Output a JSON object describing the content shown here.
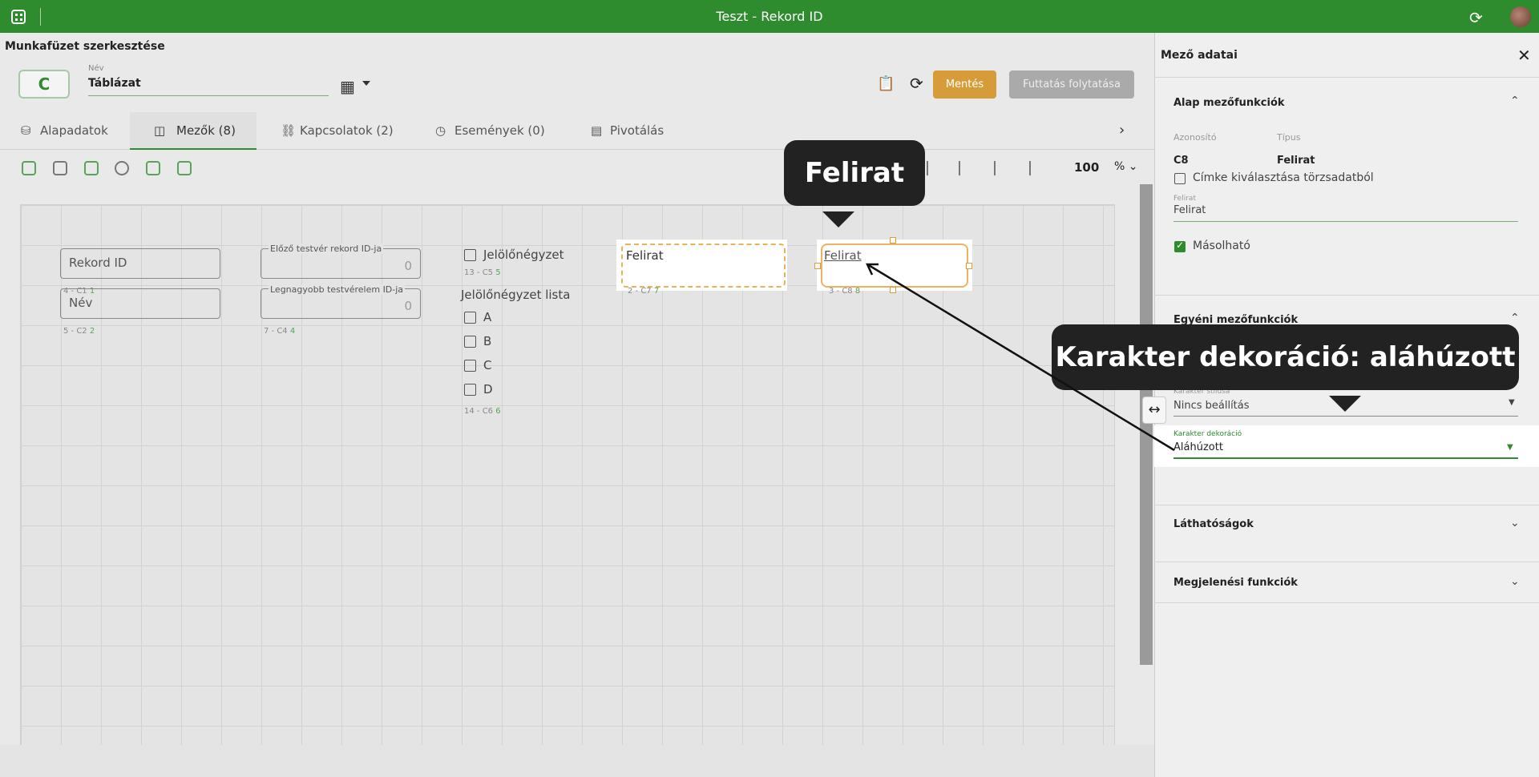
{
  "window": {
    "title": "Teszt - Rekord ID"
  },
  "header": {
    "page_title": "Munkafüzet szerkesztése",
    "logo_letter": "C",
    "name_label": "Név",
    "name_value": "Táblázat",
    "save_label": "Mentés",
    "continue_label": "Futtatás folytatása"
  },
  "tabs": [
    {
      "label": "Alapadatok",
      "icon": "database-icon"
    },
    {
      "label": "Mezők (8)",
      "icon": "fields-icon"
    },
    {
      "label": "Kapcsolatok (2)",
      "icon": "connections-icon"
    },
    {
      "label": "Események (0)",
      "icon": "events-icon"
    },
    {
      "label": "Pivotálás",
      "icon": "pivot-icon"
    }
  ],
  "toolbar": {
    "zoom": "100",
    "zoom_unit": "%"
  },
  "canvas": {
    "rekord_id": "Rekord ID",
    "rekord_meta": "4 - C1",
    "rekord_meta_n": "1",
    "nev": "Név",
    "nev_meta": "5 - C2",
    "nev_meta_n": "2",
    "elozo_label": "Előző testvér rekord ID-ja",
    "elozo_value": "0",
    "legnagyobb_label": "Legnagyobb testvérelem ID-ja",
    "legnagyobb_value": "0",
    "legnagyobb_meta": "7 - C4",
    "legnagyobb_meta_n": "4",
    "jelolo_label": "Jelölőnégyzet",
    "jelolo_meta": "13 - C5",
    "jelolo_meta_n": "5",
    "lista_label": "Jelölőnégyzet lista",
    "lista_items": [
      "A",
      "B",
      "C",
      "D"
    ],
    "lista_meta": "14 - C6",
    "lista_meta_n": "6",
    "felirat1": "Felirat",
    "felirat1_meta": "2 - C7",
    "felirat1_meta_n": "7",
    "felirat2": "Felirat",
    "felirat2_meta": "3 - C8",
    "felirat2_meta_n": "8"
  },
  "callouts": {
    "top": "Felirat",
    "right": "Karakter dekoráció: aláhúzott"
  },
  "panel": {
    "title": "Mező adatai",
    "sec_basic": "Alap mezőfunkciók",
    "id_label": "Azonosító",
    "id_value": "C8",
    "type_label": "Típus",
    "type_value": "Felirat",
    "cimke_label": "Címke kiválasztása törzsadatból",
    "felirat_label": "Felirat",
    "felirat_value": "Felirat",
    "masolhato_label": "Másolható",
    "sec_custom": "Egyéni mezőfunkciók",
    "stilus_label": "Karakter stílusa",
    "stilus_value": "Nincs beállítás",
    "dekor_label": "Karakter dekoráció",
    "dekor_value": "Aláhúzott",
    "sec_visibility": "Láthatóságok",
    "sec_display": "Megjelenési funkciók"
  }
}
